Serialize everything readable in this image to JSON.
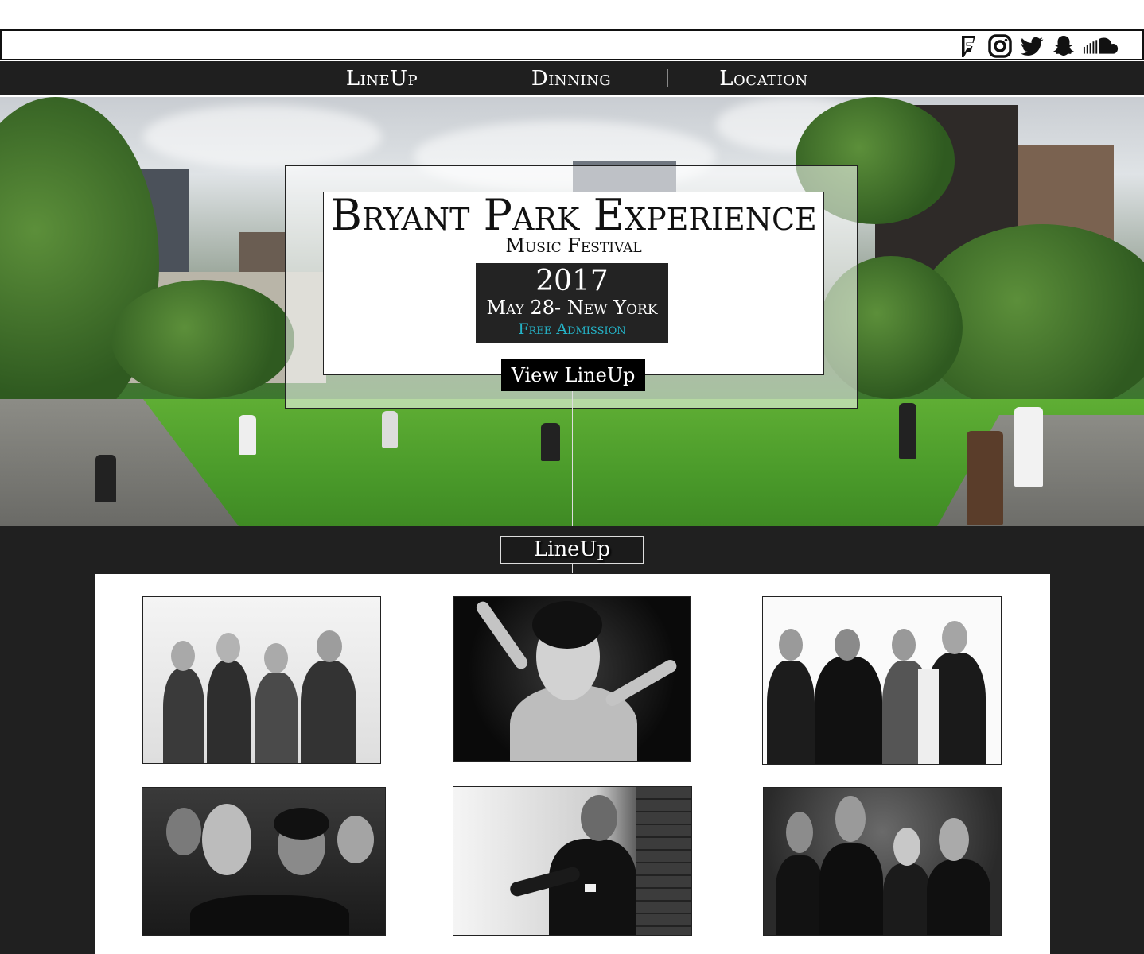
{
  "social": {
    "icons": [
      "foursquare-icon",
      "instagram-icon",
      "twitter-icon",
      "snapchat-icon",
      "soundcloud-icon"
    ]
  },
  "nav": {
    "items": [
      {
        "label": "LineUp"
      },
      {
        "label": "Dinning"
      },
      {
        "label": "Location"
      }
    ]
  },
  "hero": {
    "title": "Bryant Park Experience",
    "subtitle": "Music Festival",
    "year": "2017",
    "date": "May 28- New York",
    "admission": "Free Admission",
    "cta": "View LineUp",
    "accent": "#24b3c7"
  },
  "lineup": {
    "heading": "LineUp",
    "photos": [
      {
        "name": "band-photo-1"
      },
      {
        "name": "artist-photo-2"
      },
      {
        "name": "band-photo-3"
      },
      {
        "name": "band-photo-4"
      },
      {
        "name": "artist-photo-5"
      },
      {
        "name": "band-photo-6"
      }
    ]
  }
}
